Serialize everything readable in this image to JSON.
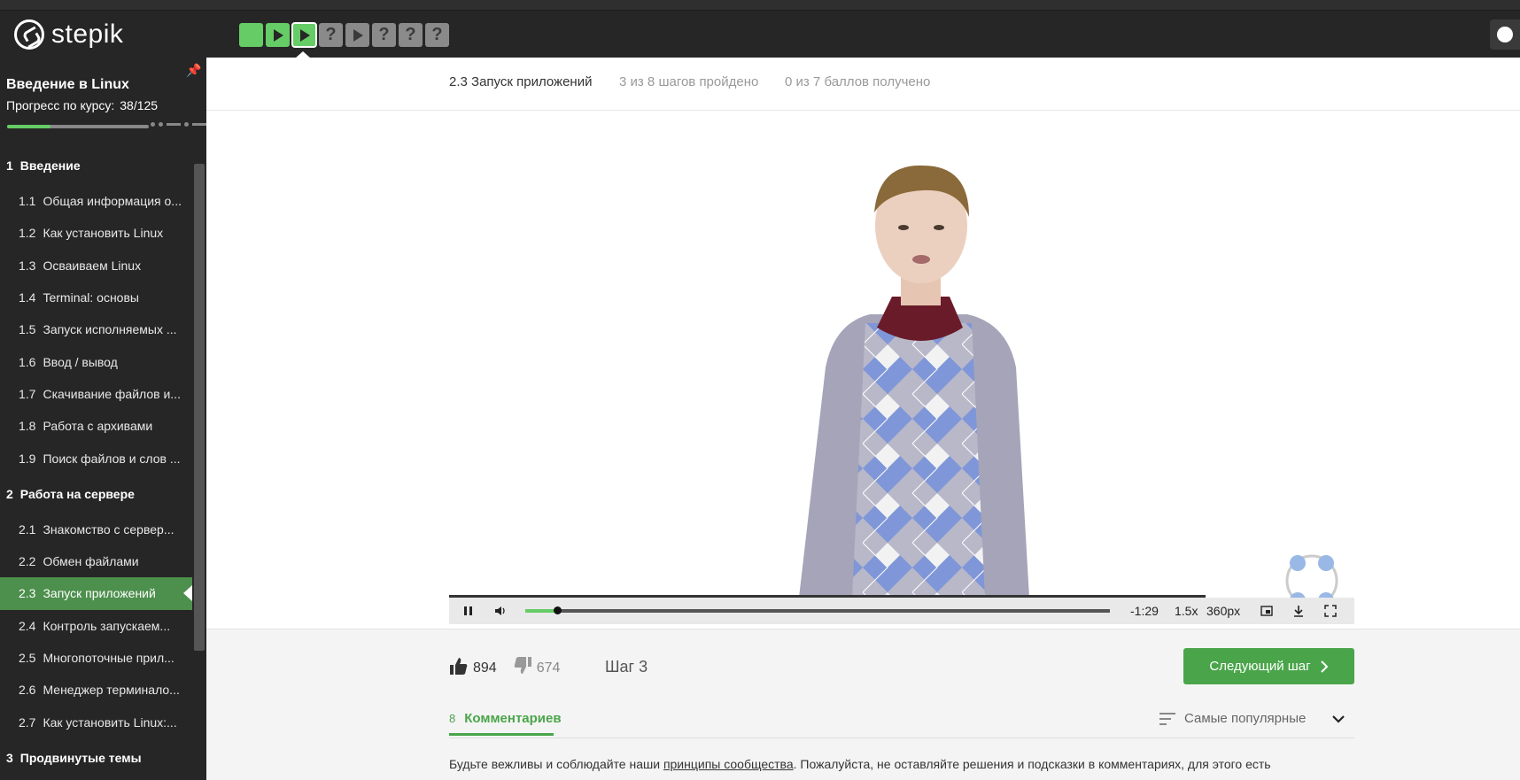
{
  "brand": {
    "name": "stepik"
  },
  "step_nav": [
    {
      "state": "done",
      "icon": ""
    },
    {
      "state": "done",
      "icon": "play-icon"
    },
    {
      "state": "current",
      "icon": "play-icon"
    },
    {
      "state": "unseen",
      "label": "?"
    },
    {
      "state": "unseen",
      "icon": "play-icon"
    },
    {
      "state": "unseen",
      "label": "?"
    },
    {
      "state": "unseen",
      "label": "?"
    },
    {
      "state": "unseen",
      "label": "?"
    }
  ],
  "sidebar": {
    "course_title": "Введение в Linux",
    "progress_label": "Прогресс по курсу:",
    "progress_value": "38/125",
    "progress_fraction": 0.304,
    "modules": [
      {
        "number": "1",
        "title": "Введение",
        "lessons": [
          {
            "number": "1.1",
            "title": "Общая информация о..."
          },
          {
            "number": "1.2",
            "title": "Как установить Linux"
          },
          {
            "number": "1.3",
            "title": "Осваиваем Linux"
          },
          {
            "number": "1.4",
            "title": "Terminal: основы"
          },
          {
            "number": "1.5",
            "title": "Запуск исполняемых ..."
          },
          {
            "number": "1.6",
            "title": "Ввод / вывод"
          },
          {
            "number": "1.7",
            "title": "Скачивание файлов и..."
          },
          {
            "number": "1.8",
            "title": "Работа с архивами"
          },
          {
            "number": "1.9",
            "title": "Поиск файлов и слов ..."
          }
        ]
      },
      {
        "number": "2",
        "title": "Работа на сервере",
        "lessons": [
          {
            "number": "2.1",
            "title": "Знакомство с сервер..."
          },
          {
            "number": "2.2",
            "title": "Обмен файлами"
          },
          {
            "number": "2.3",
            "title": "Запуск приложений",
            "active": true
          },
          {
            "number": "2.4",
            "title": "Контроль запускаем..."
          },
          {
            "number": "2.5",
            "title": "Многопоточные прил..."
          },
          {
            "number": "2.6",
            "title": "Менеджер терминало..."
          },
          {
            "number": "2.7",
            "title": "Как установить Linux:..."
          }
        ]
      },
      {
        "number": "3",
        "title": "Продвинутые темы",
        "lessons": []
      }
    ]
  },
  "lesson_header": {
    "title": "2.3 Запуск приложений",
    "steps": "3 из 8 шагов пройдено",
    "points": "0 из 7 баллов  получено"
  },
  "player": {
    "time_remaining": "-1:29",
    "speed": "1.5x",
    "quality": "360px",
    "progress_fraction": 0.055
  },
  "feedback": {
    "likes": "894",
    "dislikes": "674",
    "step_label": "Шаг 3",
    "next_button": "Следующий шаг"
  },
  "comments": {
    "count": "8",
    "tab_label": "Комментариев",
    "sort_label": "Самые популярные",
    "rules_prefix": "Будьте вежливы и соблюдайте наши ",
    "rules_link": "принципы сообщества",
    "rules_suffix": ". Пожалуйста, не оставляйте решения и подсказки в комментариях, для этого есть"
  },
  "colors": {
    "accent": "#66cc66",
    "button": "#4aa54a",
    "dark_bg": "#262626",
    "active_lesson": "#4d8f4d"
  }
}
